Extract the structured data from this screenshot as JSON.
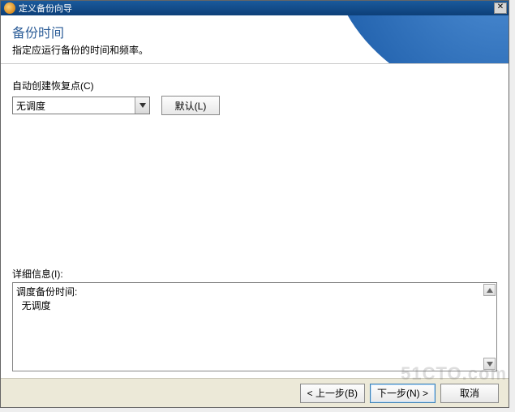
{
  "window": {
    "title": "定义备份向导"
  },
  "banner": {
    "title": "备份时间",
    "subtitle": "指定应运行备份的时间和频率。"
  },
  "schedule": {
    "label": "自动创建恢复点(C)",
    "selected_value": "无调度",
    "default_button": "默认(L)"
  },
  "details": {
    "label": "详细信息(I):",
    "line1": "调度备份时间:",
    "line2": "  无调度"
  },
  "footer": {
    "back": "< 上一步(B)",
    "next": "下一步(N) >",
    "cancel": "取消"
  },
  "watermark": "51CTO.com"
}
